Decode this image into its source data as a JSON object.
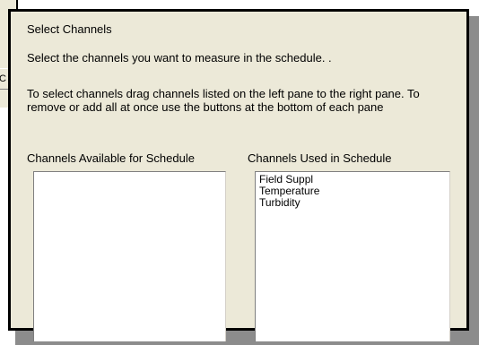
{
  "background_window": {
    "button_label": "C"
  },
  "dialog": {
    "heading": "Select Channels",
    "instruction_line1": "Select the channels you want to measure in the schedule. .",
    "instruction_line2": "To select channels drag channels listed on the left pane to the right pane. To remove or add all at once use the buttons at the bottom of each pane",
    "available": {
      "label": "Channels Available for Schedule",
      "items": []
    },
    "used": {
      "label": "Channels Used in Schedule",
      "items": [
        "Field Suppl",
        "Temperature",
        "Turbidity"
      ]
    }
  },
  "colors": {
    "panel_bg": "#ece9d8",
    "border": "#000000",
    "shadow": "#8c8c8c",
    "list_bg": "#ffffff"
  }
}
